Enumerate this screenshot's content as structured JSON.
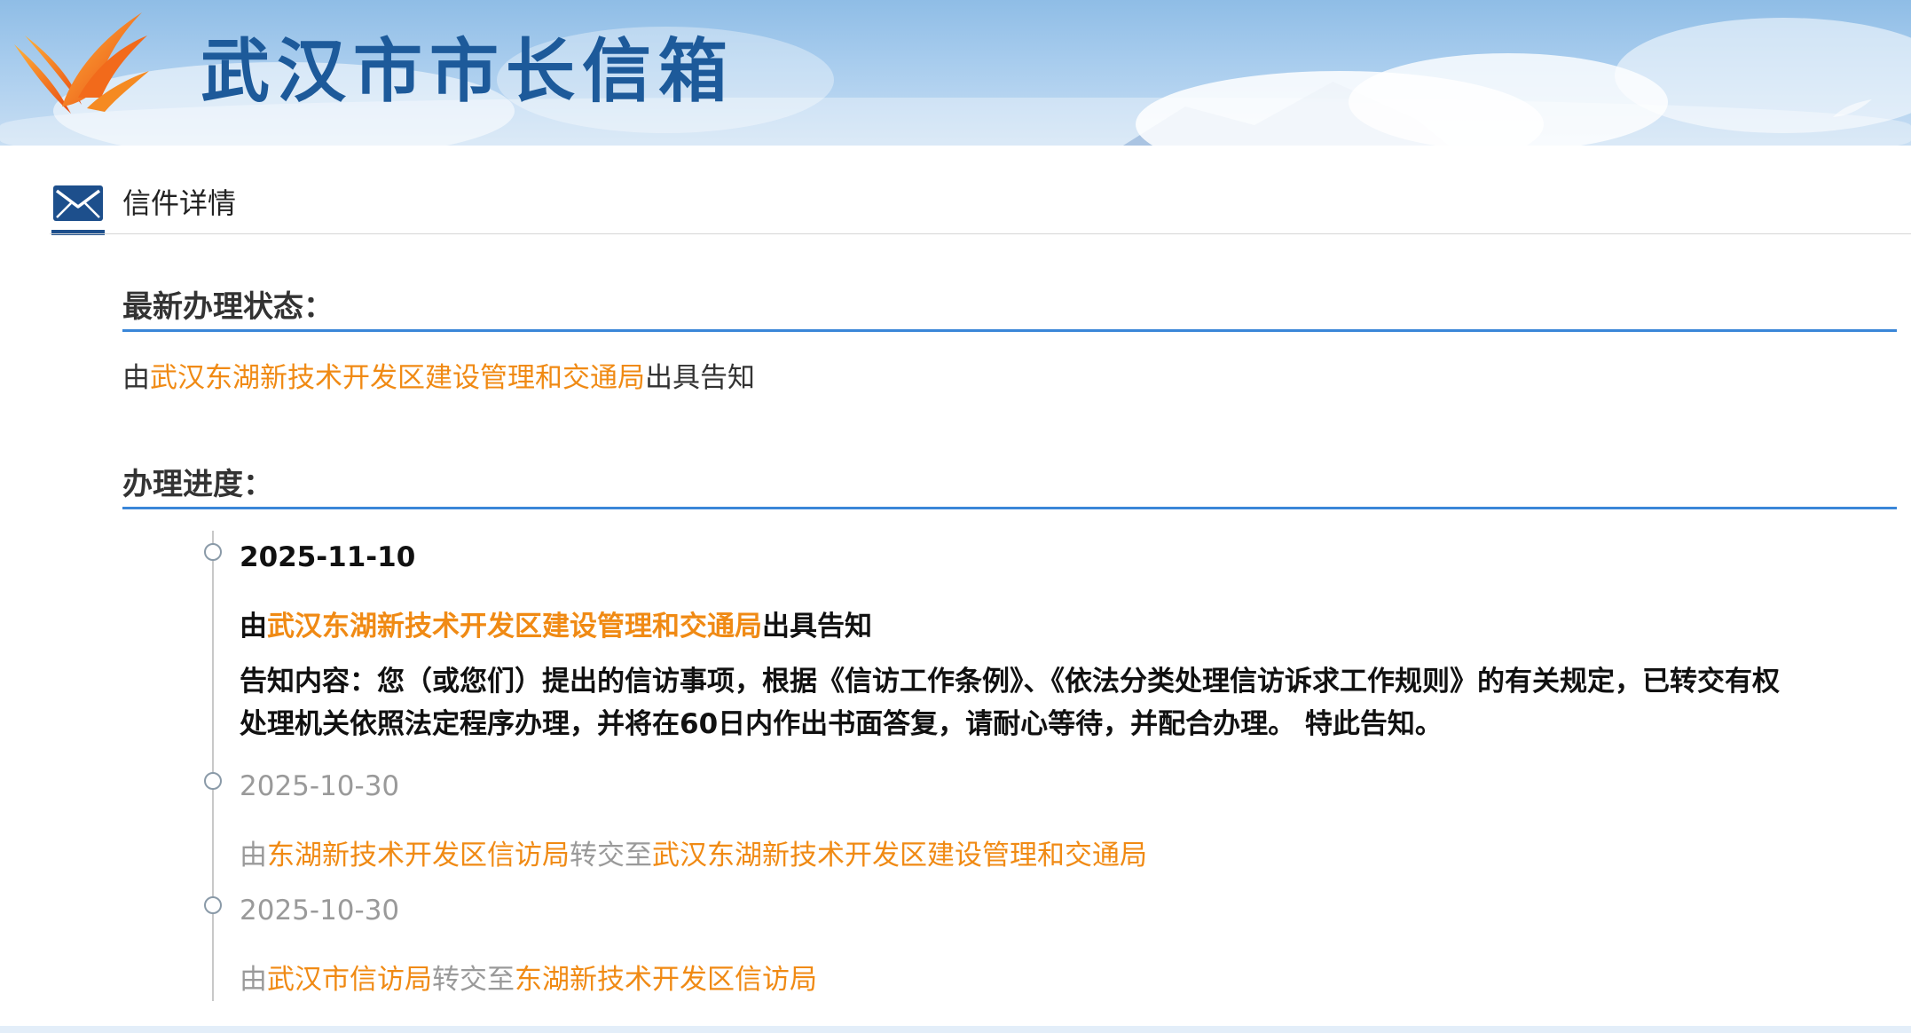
{
  "header": {
    "site_title": "武汉市市长信箱"
  },
  "section": {
    "title": "信件详情"
  },
  "latest_status": {
    "heading": "最新办理状态：",
    "prefix": "由",
    "org": "武汉东湖新技术开发区建设管理和交通局",
    "suffix": "出具告知"
  },
  "progress": {
    "heading": "办理进度：",
    "entries": [
      {
        "date": "2025-11-10",
        "prefix": "由",
        "org": "武汉东湖新技术开发区建设管理和交通局",
        "suffix": "出具告知",
        "notice": "告知内容：您（或您们）提出的信访事项，根据《信访工作条例》、《依法分类处理信访诉求工作规则》的有关规定，已转交有权处理机关依照法定程序办理，并将在60日内作出书面答复，请耐心等待，并配合办理。 特此告知。"
      },
      {
        "date": "2025-10-30",
        "prefix": "由",
        "from_org": "东湖新技术开发区信访局",
        "middle": "转交至",
        "to_org": "武汉东湖新技术开发区建设管理和交通局"
      },
      {
        "date": "2025-10-30",
        "prefix": "由",
        "from_org": "武汉市信访局",
        "middle": "转交至",
        "to_org": "东湖新技术开发区信访局"
      }
    ]
  },
  "colors": {
    "accent_blue": "#3a86d8",
    "title_blue": "#1d5a9a",
    "org_orange": "#f08a14",
    "done_grey": "#9a9a9a"
  },
  "icons": [
    "phoenix-logo-icon",
    "mail-icon",
    "timeline-dot-icon"
  ]
}
